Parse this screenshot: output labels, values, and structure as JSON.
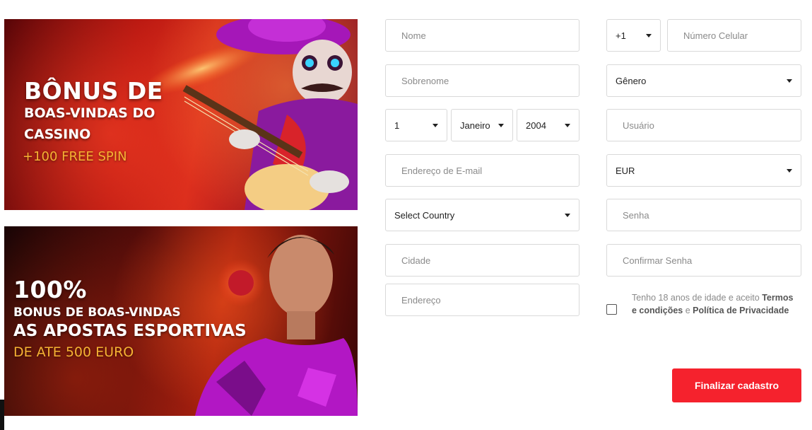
{
  "banners": {
    "casino": {
      "line1": "BÔNUS DE",
      "line2": "BOAS-VINDAS DO",
      "line3": "CASSINO",
      "line4": "+100 FREE SPIN"
    },
    "sports": {
      "line1": "100%",
      "line2": "BONUS DE BOAS-VINDAS",
      "line3": "AS APOSTAS ESPORTIVAS",
      "line4": "DE ATE 500 EURO"
    }
  },
  "form": {
    "nome_placeholder": "Nome",
    "sobrenome_placeholder": "Sobrenome",
    "birth_day": "1",
    "birth_month": "Janeiro",
    "birth_year": "2004",
    "email_placeholder": "Endereço de E-mail",
    "country": "Select Country",
    "cidade_placeholder": "Cidade",
    "endereco_placeholder": "Endereço",
    "phone_code": "+1",
    "phone_placeholder": "Número Celular",
    "genero": "Gênero",
    "usuario_placeholder": "Usuário",
    "currency": "EUR",
    "senha_placeholder": "Senha",
    "confirmar_placeholder": "Confirmar Senha",
    "terms_prefix": "Tenho 18 anos de idade e aceito",
    "terms_link": "Termos e condições",
    "terms_and": "e",
    "privacy_link": "Política de Privacidade",
    "submit_label": "Finalizar cadastro"
  },
  "colors": {
    "accent": "#f5222d",
    "gold": "#f6b233"
  }
}
